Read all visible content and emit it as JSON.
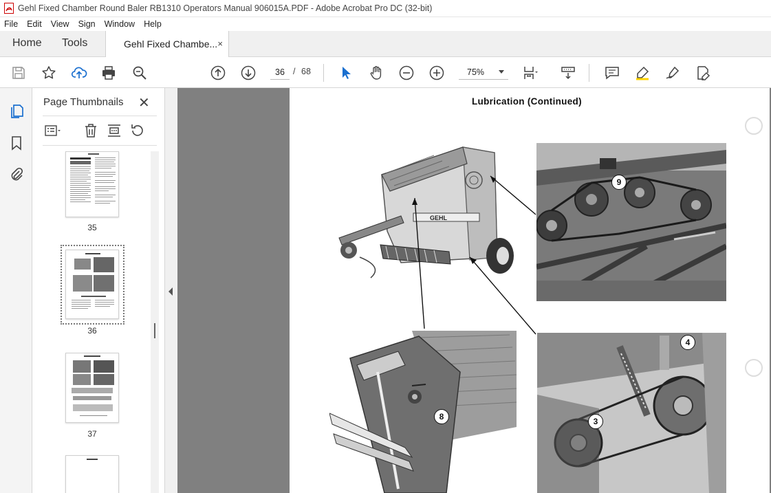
{
  "window": {
    "title": "Gehl Fixed Chamber Round Baler RB1310 Operators Manual 906015A.PDF - Adobe Acrobat Pro DC (32-bit)"
  },
  "menu": [
    "File",
    "Edit",
    "View",
    "Sign",
    "Window",
    "Help"
  ],
  "tabs": {
    "home": "Home",
    "tools": "Tools",
    "document": "Gehl Fixed Chambe...",
    "close_glyph": "×"
  },
  "toolbar": {
    "current_page": "36",
    "page_separator": "/",
    "total_pages": "68",
    "zoom": "75%",
    "icons": [
      "save-icon",
      "bookmark-star-icon",
      "cloud-upload-icon",
      "print-icon",
      "search-zoom-icon",
      "page-up-icon",
      "page-down-icon",
      "select-cursor-icon",
      "hand-pan-icon",
      "zoom-out-icon",
      "zoom-in-icon",
      "fit-page-icon",
      "scroll-mode-icon",
      "comment-icon",
      "highlight-pen-icon",
      "sign-pen-icon",
      "edit-pdf-icon"
    ]
  },
  "sidebar_rail": {
    "icons": [
      "page-thumbnails-icon",
      "bookmarks-icon",
      "attachments-icon"
    ]
  },
  "thumbnails_panel": {
    "title": "Page Thumbnails",
    "close_glyph": "✕",
    "thumbnails": [
      {
        "page_label": "35",
        "selected": false
      },
      {
        "page_label": "36",
        "selected": true
      },
      {
        "page_label": "37",
        "selected": false
      },
      {
        "page_label": "",
        "selected": false
      }
    ]
  },
  "document_page": {
    "heading": "Lubrication (Continued)",
    "callouts": [
      "9",
      "8",
      "4",
      "3"
    ],
    "machine_brand": "GEHL"
  },
  "colors": {
    "accent_blue": "#1a6fcf",
    "viewer_gray": "#808080",
    "tab_bar": "#f0f0f0"
  }
}
